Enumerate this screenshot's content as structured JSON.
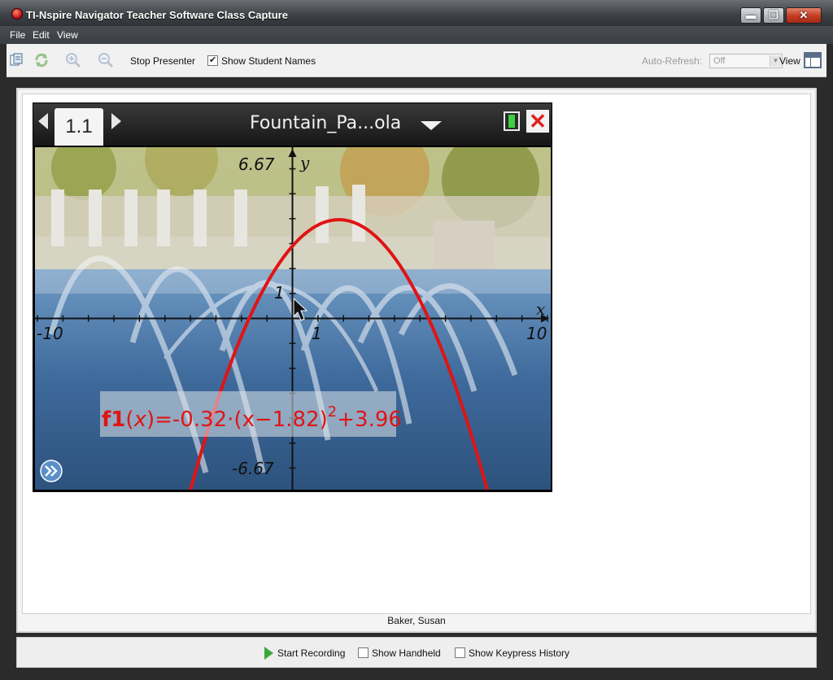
{
  "window": {
    "title": "TI-Nspire Navigator Teacher Software Class Capture",
    "minimize_glyph": "▬",
    "maximize_glyph": "❐",
    "close_glyph": "✕"
  },
  "menu": {
    "items": [
      "File",
      "Edit",
      "View"
    ]
  },
  "toolbar": {
    "stop_presenter": "Stop Presenter",
    "show_student_names": "Show Student Names",
    "show_student_names_checked": true,
    "auto_refresh_label": "Auto-Refresh:",
    "auto_refresh_value": "Off",
    "view_label": "View",
    "icons": [
      "class-list-icon",
      "refresh-icon",
      "zoom-in-icon",
      "zoom-out-icon",
      "view-layout-icon"
    ]
  },
  "capture": {
    "tab_label": "1.1",
    "document_title": "Fountain_Pa...ola",
    "student_name": "Baker, Susan",
    "graph": {
      "xmin": -10,
      "xmax": 10,
      "ymin": -6.67,
      "ymax": 6.67,
      "x_min_label": "-10",
      "x_max_label": "10",
      "y_max_label": "6.67",
      "y_min_label": "-6.67",
      "x_tick_label": "1",
      "y_tick_label": "1",
      "x_axis_name": "x",
      "y_axis_name": "y",
      "function": {
        "a": -0.32,
        "h": 1.82,
        "k": 3.96
      },
      "function_label": {
        "name": "f1",
        "paren_open": "(",
        "var": "x",
        "paren_close": ")",
        "eq": "=-0.32·",
        "inner": "(x−1.82)",
        "exp": "2",
        "tail": "+3.96"
      },
      "curve_color": "#e01414"
    }
  },
  "bottom": {
    "start_recording": "Start Recording",
    "show_handheld": "Show Handheld",
    "show_handheld_checked": false,
    "show_keypress_history": "Show Keypress History",
    "show_keypress_history_checked": false
  }
}
